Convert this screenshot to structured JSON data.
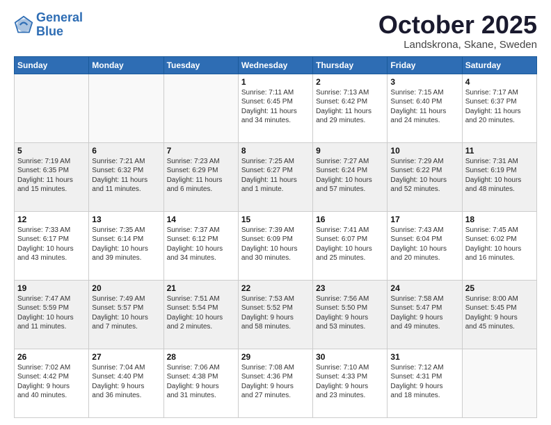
{
  "logo": {
    "line1": "General",
    "line2": "Blue"
  },
  "title": "October 2025",
  "location": "Landskrona, Skane, Sweden",
  "days_header": [
    "Sunday",
    "Monday",
    "Tuesday",
    "Wednesday",
    "Thursday",
    "Friday",
    "Saturday"
  ],
  "weeks": [
    {
      "shaded": false,
      "days": [
        {
          "num": "",
          "info": ""
        },
        {
          "num": "",
          "info": ""
        },
        {
          "num": "",
          "info": ""
        },
        {
          "num": "1",
          "info": "Sunrise: 7:11 AM\nSunset: 6:45 PM\nDaylight: 11 hours\nand 34 minutes."
        },
        {
          "num": "2",
          "info": "Sunrise: 7:13 AM\nSunset: 6:42 PM\nDaylight: 11 hours\nand 29 minutes."
        },
        {
          "num": "3",
          "info": "Sunrise: 7:15 AM\nSunset: 6:40 PM\nDaylight: 11 hours\nand 24 minutes."
        },
        {
          "num": "4",
          "info": "Sunrise: 7:17 AM\nSunset: 6:37 PM\nDaylight: 11 hours\nand 20 minutes."
        }
      ]
    },
    {
      "shaded": true,
      "days": [
        {
          "num": "5",
          "info": "Sunrise: 7:19 AM\nSunset: 6:35 PM\nDaylight: 11 hours\nand 15 minutes."
        },
        {
          "num": "6",
          "info": "Sunrise: 7:21 AM\nSunset: 6:32 PM\nDaylight: 11 hours\nand 11 minutes."
        },
        {
          "num": "7",
          "info": "Sunrise: 7:23 AM\nSunset: 6:29 PM\nDaylight: 11 hours\nand 6 minutes."
        },
        {
          "num": "8",
          "info": "Sunrise: 7:25 AM\nSunset: 6:27 PM\nDaylight: 11 hours\nand 1 minute."
        },
        {
          "num": "9",
          "info": "Sunrise: 7:27 AM\nSunset: 6:24 PM\nDaylight: 10 hours\nand 57 minutes."
        },
        {
          "num": "10",
          "info": "Sunrise: 7:29 AM\nSunset: 6:22 PM\nDaylight: 10 hours\nand 52 minutes."
        },
        {
          "num": "11",
          "info": "Sunrise: 7:31 AM\nSunset: 6:19 PM\nDaylight: 10 hours\nand 48 minutes."
        }
      ]
    },
    {
      "shaded": false,
      "days": [
        {
          "num": "12",
          "info": "Sunrise: 7:33 AM\nSunset: 6:17 PM\nDaylight: 10 hours\nand 43 minutes."
        },
        {
          "num": "13",
          "info": "Sunrise: 7:35 AM\nSunset: 6:14 PM\nDaylight: 10 hours\nand 39 minutes."
        },
        {
          "num": "14",
          "info": "Sunrise: 7:37 AM\nSunset: 6:12 PM\nDaylight: 10 hours\nand 34 minutes."
        },
        {
          "num": "15",
          "info": "Sunrise: 7:39 AM\nSunset: 6:09 PM\nDaylight: 10 hours\nand 30 minutes."
        },
        {
          "num": "16",
          "info": "Sunrise: 7:41 AM\nSunset: 6:07 PM\nDaylight: 10 hours\nand 25 minutes."
        },
        {
          "num": "17",
          "info": "Sunrise: 7:43 AM\nSunset: 6:04 PM\nDaylight: 10 hours\nand 20 minutes."
        },
        {
          "num": "18",
          "info": "Sunrise: 7:45 AM\nSunset: 6:02 PM\nDaylight: 10 hours\nand 16 minutes."
        }
      ]
    },
    {
      "shaded": true,
      "days": [
        {
          "num": "19",
          "info": "Sunrise: 7:47 AM\nSunset: 5:59 PM\nDaylight: 10 hours\nand 11 minutes."
        },
        {
          "num": "20",
          "info": "Sunrise: 7:49 AM\nSunset: 5:57 PM\nDaylight: 10 hours\nand 7 minutes."
        },
        {
          "num": "21",
          "info": "Sunrise: 7:51 AM\nSunset: 5:54 PM\nDaylight: 10 hours\nand 2 minutes."
        },
        {
          "num": "22",
          "info": "Sunrise: 7:53 AM\nSunset: 5:52 PM\nDaylight: 9 hours\nand 58 minutes."
        },
        {
          "num": "23",
          "info": "Sunrise: 7:56 AM\nSunset: 5:50 PM\nDaylight: 9 hours\nand 53 minutes."
        },
        {
          "num": "24",
          "info": "Sunrise: 7:58 AM\nSunset: 5:47 PM\nDaylight: 9 hours\nand 49 minutes."
        },
        {
          "num": "25",
          "info": "Sunrise: 8:00 AM\nSunset: 5:45 PM\nDaylight: 9 hours\nand 45 minutes."
        }
      ]
    },
    {
      "shaded": false,
      "days": [
        {
          "num": "26",
          "info": "Sunrise: 7:02 AM\nSunset: 4:42 PM\nDaylight: 9 hours\nand 40 minutes."
        },
        {
          "num": "27",
          "info": "Sunrise: 7:04 AM\nSunset: 4:40 PM\nDaylight: 9 hours\nand 36 minutes."
        },
        {
          "num": "28",
          "info": "Sunrise: 7:06 AM\nSunset: 4:38 PM\nDaylight: 9 hours\nand 31 minutes."
        },
        {
          "num": "29",
          "info": "Sunrise: 7:08 AM\nSunset: 4:36 PM\nDaylight: 9 hours\nand 27 minutes."
        },
        {
          "num": "30",
          "info": "Sunrise: 7:10 AM\nSunset: 4:33 PM\nDaylight: 9 hours\nand 23 minutes."
        },
        {
          "num": "31",
          "info": "Sunrise: 7:12 AM\nSunset: 4:31 PM\nDaylight: 9 hours\nand 18 minutes."
        },
        {
          "num": "",
          "info": ""
        }
      ]
    }
  ]
}
